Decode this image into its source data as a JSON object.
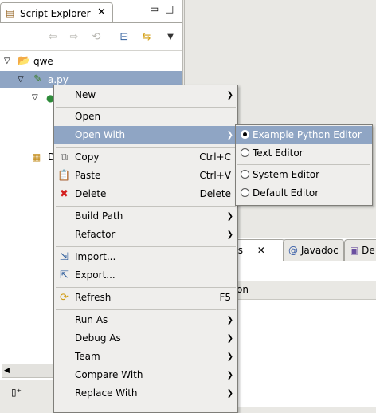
{
  "explorer": {
    "tab_title": "Script Explorer",
    "tree": [
      {
        "label": "qwe",
        "expanded": true
      },
      {
        "label": "a.py",
        "expanded": true,
        "selected": true
      },
      {
        "label": "",
        "expanded": true
      },
      {
        "label": "D"
      }
    ]
  },
  "lower_tabs": {
    "problems_fragment": "ms",
    "javadoc": "Javadoc",
    "declaration_fragment": "De",
    "column_header_fragment": "on"
  },
  "context_menu": {
    "new": "New",
    "open": "Open",
    "open_with": "Open With",
    "copy": "Copy",
    "copy_shortcut": "Ctrl+C",
    "paste": "Paste",
    "paste_shortcut": "Ctrl+V",
    "delete": "Delete",
    "delete_shortcut": "Delete",
    "build_path": "Build Path",
    "refactor": "Refactor",
    "import": "Import...",
    "export": "Export...",
    "refresh": "Refresh",
    "refresh_shortcut": "F5",
    "run_as": "Run As",
    "debug_as": "Debug As",
    "team": "Team",
    "compare_with": "Compare With",
    "replace_with": "Replace With"
  },
  "open_with_submenu": {
    "items": [
      {
        "label": "Example Python Editor",
        "selected": true
      },
      {
        "label": "Text Editor",
        "selected": false
      },
      {
        "label": "System Editor",
        "selected": false
      },
      {
        "label": "Default Editor",
        "selected": false
      }
    ]
  },
  "colors": {
    "selection": "#8fa5c4",
    "menu_bg": "#efeeec",
    "chrome_bg": "#e9e8e4"
  }
}
